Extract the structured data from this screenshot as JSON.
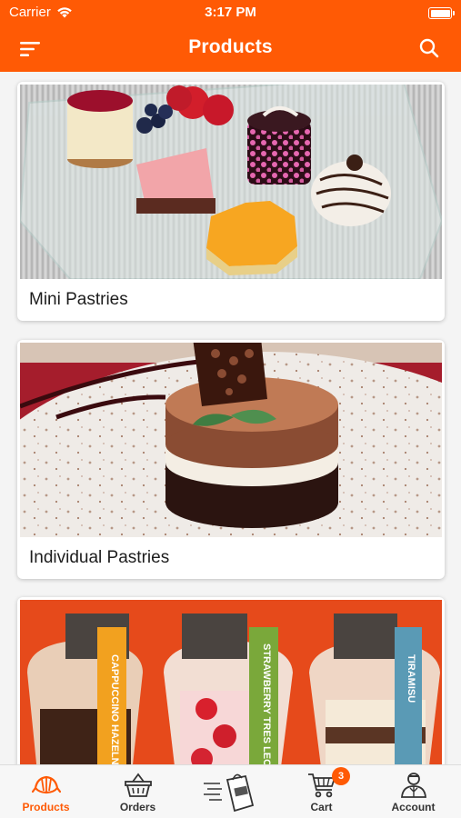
{
  "status_bar": {
    "carrier": "Carrier",
    "time": "3:17 PM"
  },
  "header": {
    "title": "Products",
    "menu_icon": "menu-icon",
    "search_icon": "search-icon"
  },
  "products": [
    {
      "title": "Mini Pastries",
      "image": "mini-pastries-photo"
    },
    {
      "title": "Individual Pastries",
      "image": "individual-pastries-photo"
    },
    {
      "title": "",
      "image": "cup-desserts-photo",
      "cup_labels": [
        "CAPPUCCINO HAZELNUT",
        "STRAWBERRY TRES LECHES",
        "TIRAMISU"
      ]
    }
  ],
  "tab_bar": {
    "items": [
      {
        "label": "Products",
        "icon": "croissant-icon",
        "active": true
      },
      {
        "label": "Orders",
        "icon": "basket-icon"
      },
      {
        "label": "",
        "icon": "delivery-bag-icon"
      },
      {
        "label": "Cart",
        "icon": "cart-icon",
        "badge": "3"
      },
      {
        "label": "Account",
        "icon": "user-icon"
      }
    ]
  },
  "colors": {
    "brand": "#ff5a05",
    "tab_active": "#ff5a05",
    "tab_inactive": "#333333"
  }
}
